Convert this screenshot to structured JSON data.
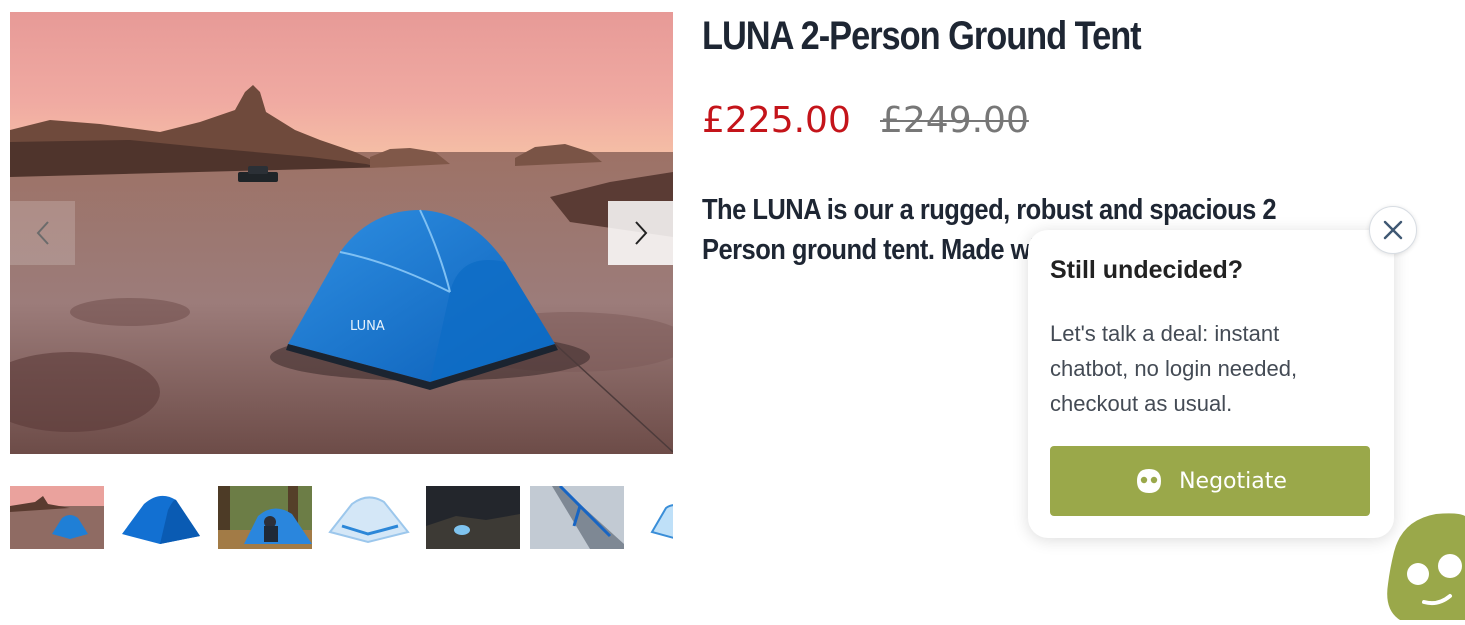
{
  "product": {
    "title": "LUNA 2-Person Ground Tent",
    "price_current": "£225.00",
    "price_original": "£249.00",
    "description": "The LUNA is our a rugged, robust and spacious 2 Person ground tent. Made with pro",
    "image_brand_text": "LUNA"
  },
  "gallery": {
    "prev_icon": "chevron-left-icon",
    "next_icon": "chevron-right-icon",
    "thumbnail_count_visible": 7
  },
  "popup": {
    "title": "Still undecided?",
    "body": "Let's talk a deal: instant chatbot, no login needed, checkout as usual.",
    "button_label": "Negotiate",
    "button_icon": "chatbot-face-icon",
    "close_icon": "close-icon"
  },
  "colors": {
    "price_current": "#c4141a",
    "price_original": "#777777",
    "button_bg": "#9aa84a",
    "title_text": "#1e2633"
  }
}
